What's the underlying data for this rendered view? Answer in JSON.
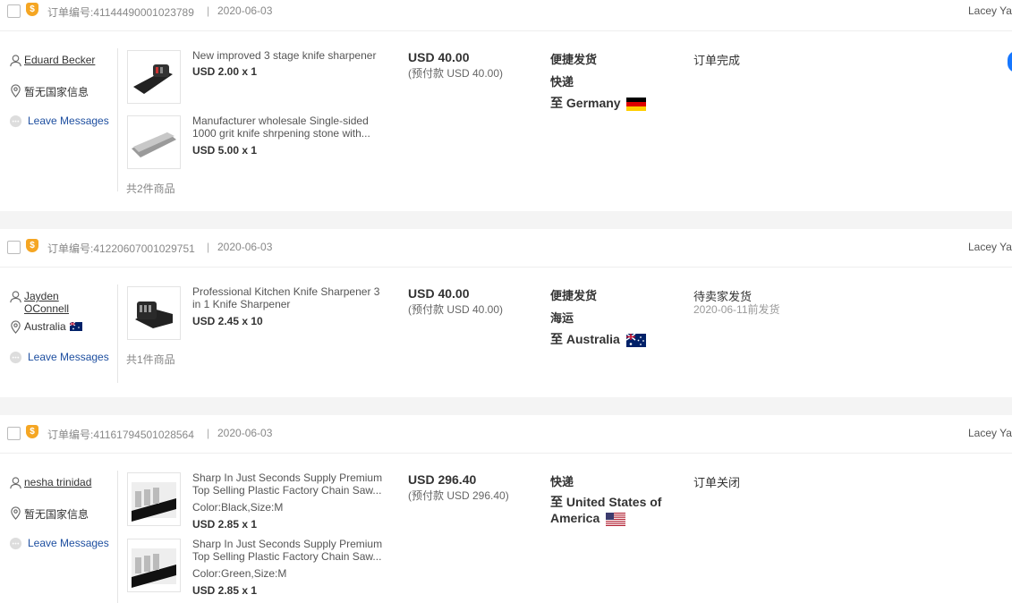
{
  "orders": [
    {
      "order_no": "订单编号:41144490001023789",
      "date": "2020-06-03",
      "seller": "Lacey Ya",
      "customer_name": "Eduard Becker",
      "country": "暂无国家信息",
      "leave_messages": "Leave Messages",
      "products": [
        {
          "name": "New improved 3 stage knife sharpener",
          "qty": "USD 2.00 x 1"
        },
        {
          "name": "Manufacturer wholesale Single-sided 1000 grit knife shrpening stone with...",
          "qty": "USD 5.00 x 1"
        }
      ],
      "item_count": "共2件商品",
      "total": "USD 40.00",
      "prepay": "(预付款 USD 40.00)",
      "ship_type": "便捷发货",
      "ship_method": "快递",
      "destination": "至 Germany",
      "status": "订单完成"
    },
    {
      "order_no": "订单编号:41220607001029751",
      "date": "2020-06-03",
      "seller": "Lacey Ya",
      "customer_name": "Jayden OConnell",
      "country": "Australia",
      "leave_messages": "Leave Messages",
      "products": [
        {
          "name": "Professional Kitchen Knife Sharpener 3 in 1 Knife Sharpener",
          "qty": "USD 2.45 x 10"
        }
      ],
      "item_count": "共1件商品",
      "total": "USD 40.00",
      "prepay": "(预付款 USD 40.00)",
      "ship_type": "便捷发货",
      "ship_method": "海运",
      "destination": "至 Australia",
      "status": "待卖家发货",
      "deadline": "2020-06-11前发货"
    },
    {
      "order_no": "订单编号:41161794501028564",
      "date": "2020-06-03",
      "seller": "Lacey Ya",
      "customer_name": "nesha trinidad",
      "country": "暂无国家信息",
      "leave_messages": "Leave Messages",
      "products": [
        {
          "name": "Sharp In Just Seconds Supply Premium Top Selling Plastic Factory Chain Saw...",
          "variant": "Color:Black,Size:M",
          "qty": "USD 2.85 x 1"
        },
        {
          "name": "Sharp In Just Seconds Supply Premium Top Selling Plastic Factory Chain Saw...",
          "variant": "Color:Green,Size:M",
          "qty": "USD 2.85 x 1"
        }
      ],
      "total": "USD 296.40",
      "prepay": "(预付款 USD 296.40)",
      "ship_method": "快递",
      "destination": "至 United States of America",
      "status": "订单关闭"
    }
  ],
  "separator": "|",
  "colors": {
    "badge": "#f5a623",
    "link": "#1e4fa0",
    "accent": "#1677ff"
  }
}
